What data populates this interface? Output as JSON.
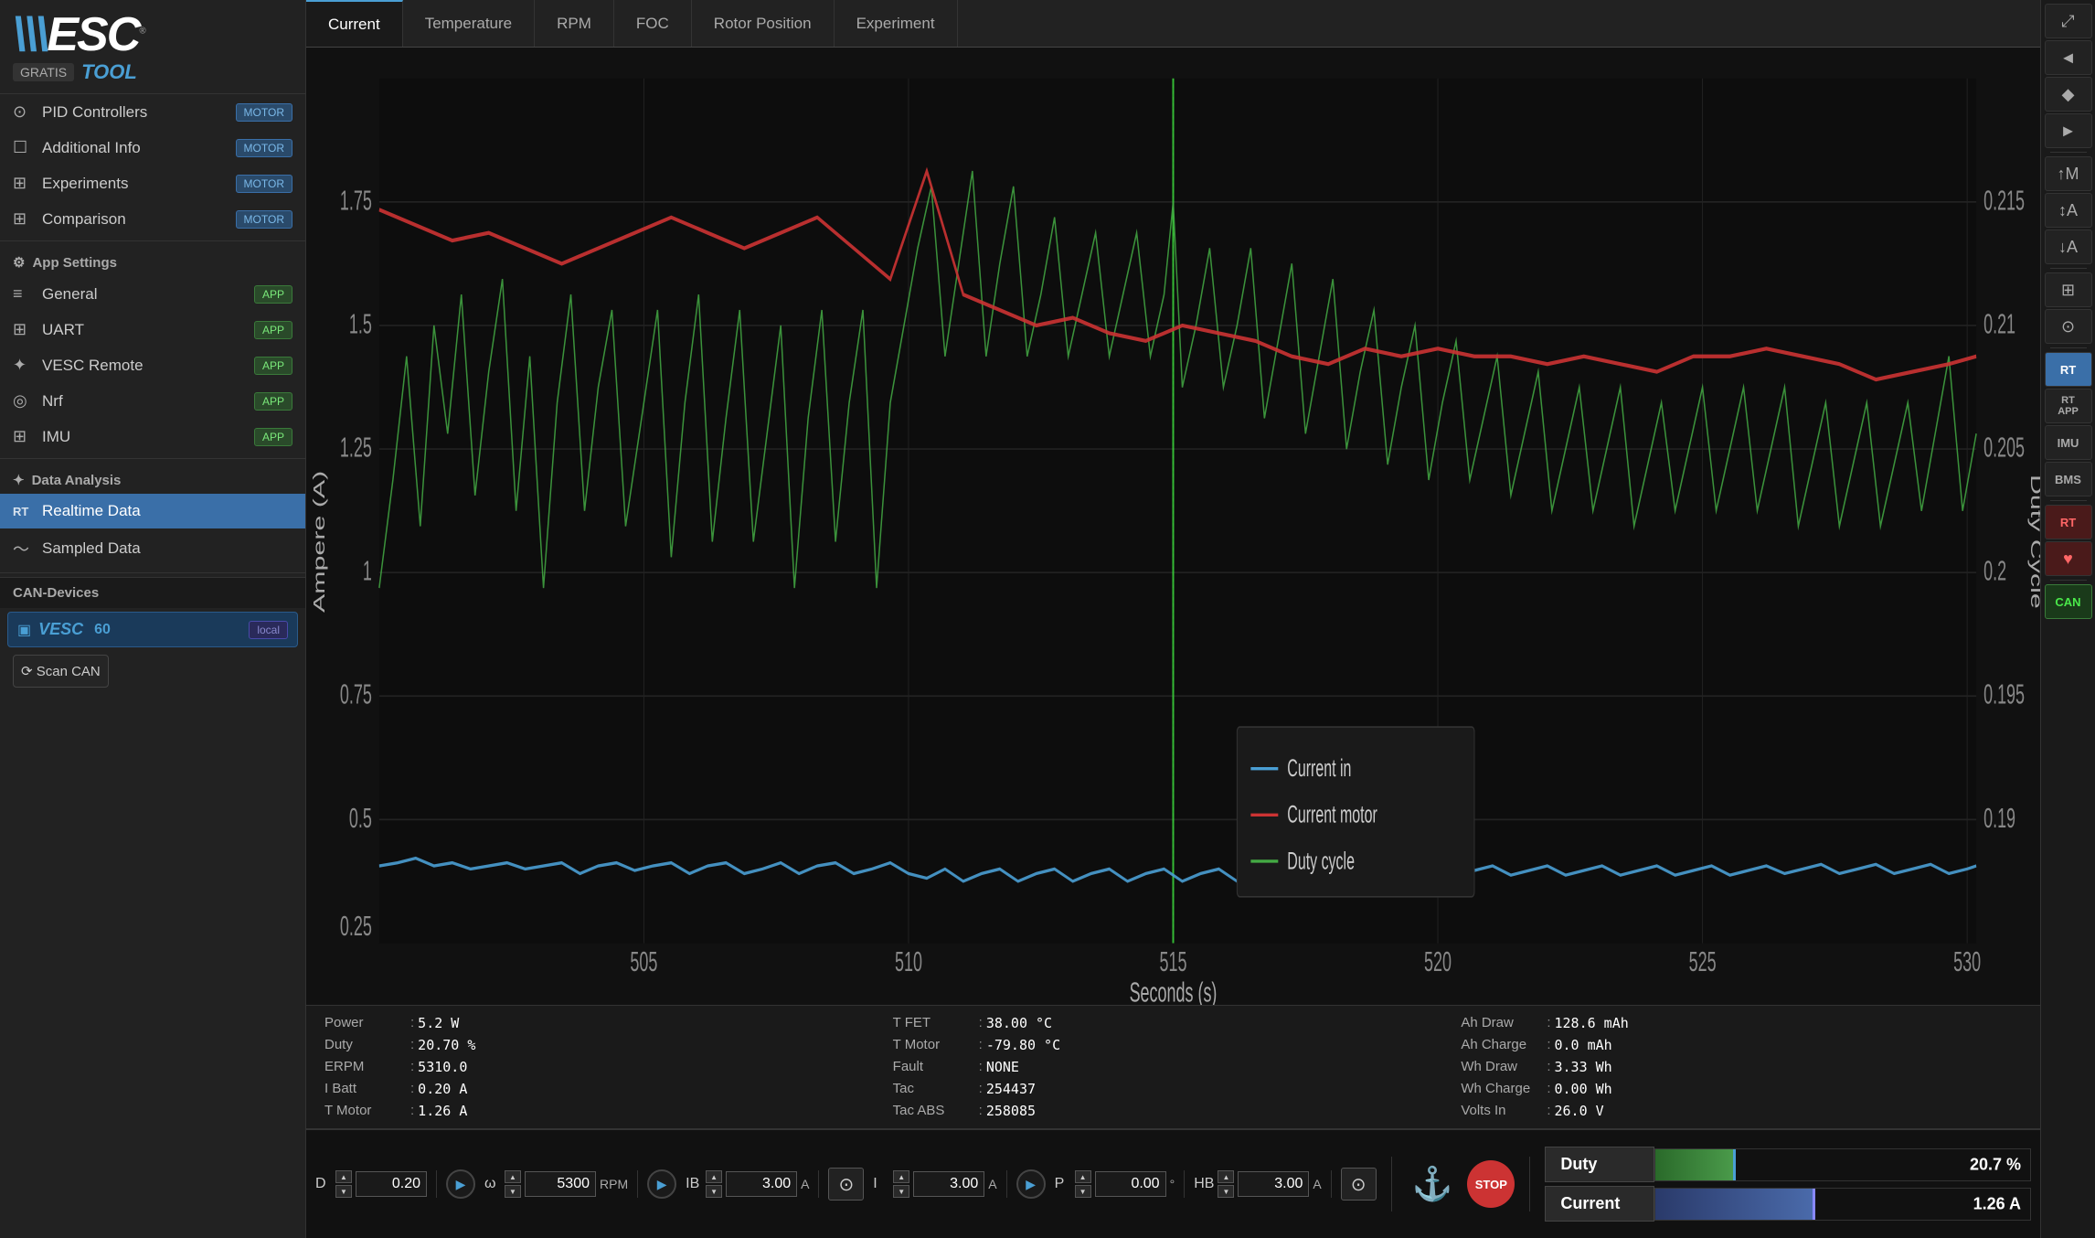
{
  "app": {
    "title": "VESC Tool"
  },
  "logo": {
    "brand": "VESC",
    "gratis": "GRATIS",
    "tool": "TOOL",
    "reg": "®"
  },
  "sidebar": {
    "motor_items": [
      {
        "id": "pid-controllers",
        "label": "PID Controllers",
        "badge": "MOTOR",
        "icon": "⊙"
      },
      {
        "id": "additional-info",
        "label": "Additional Info",
        "badge": "MOTOR",
        "icon": "☐"
      },
      {
        "id": "experiments",
        "label": "Experiments",
        "badge": "MOTOR",
        "icon": "⊞"
      },
      {
        "id": "comparison",
        "label": "Comparison",
        "badge": "MOTOR",
        "icon": "⊞"
      }
    ],
    "app_settings_header": "App Settings",
    "app_items": [
      {
        "id": "general",
        "label": "General",
        "badge": "APP",
        "icon": "≡"
      },
      {
        "id": "uart",
        "label": "UART",
        "badge": "APP",
        "icon": "⊞"
      },
      {
        "id": "vesc-remote",
        "label": "VESC Remote",
        "badge": "APP",
        "icon": "✦"
      },
      {
        "id": "nrf",
        "label": "Nrf",
        "badge": "APP",
        "icon": "((·))"
      },
      {
        "id": "imu",
        "label": "IMU",
        "badge": "APP",
        "icon": "⊞"
      }
    ],
    "data_analysis_header": "Data Analysis",
    "data_items": [
      {
        "id": "realtime-data",
        "label": "Realtime Data",
        "icon": "RT",
        "active": true
      },
      {
        "id": "sampled-data",
        "label": "Sampled Data",
        "icon": "~"
      }
    ],
    "can_devices_header": "CAN-Devices",
    "can_device": {
      "name": "VESC 60",
      "badge": "local",
      "icon": "▣"
    },
    "scan_can_label": "⟳ Scan CAN"
  },
  "tabs": [
    {
      "id": "current",
      "label": "Current",
      "active": true
    },
    {
      "id": "temperature",
      "label": "Temperature"
    },
    {
      "id": "rpm",
      "label": "RPM"
    },
    {
      "id": "foc",
      "label": "FOC"
    },
    {
      "id": "rotor-position",
      "label": "Rotor Position"
    },
    {
      "id": "experiment",
      "label": "Experiment"
    }
  ],
  "chart": {
    "y_axis_left_label": "Ampere (A)",
    "y_axis_right_label": "Duty Cycle",
    "x_axis_label": "Seconds (s)",
    "x_ticks": [
      "505",
      "510",
      "515",
      "520",
      "525",
      "530"
    ],
    "y_left_ticks": [
      "0.25",
      "0.5",
      "0.75",
      "1",
      "1.25",
      "1.5",
      "1.75"
    ],
    "y_right_ticks": [
      "0.19",
      "0.195",
      "0.2",
      "0.205",
      "0.21",
      "0.215"
    ],
    "legend": [
      {
        "id": "current-in",
        "label": "Current in",
        "color": "#4a9fd4"
      },
      {
        "id": "current-motor",
        "label": "Current motor",
        "color": "#cc3333"
      },
      {
        "id": "duty-cycle",
        "label": "Duty cycle",
        "color": "#4a8a4a"
      }
    ]
  },
  "stats": {
    "col1": [
      {
        "key": "Power",
        "sep": ":",
        "val": "5.2 W"
      },
      {
        "key": "Duty",
        "sep": ":",
        "val": "20.70 %"
      },
      {
        "key": "ERPM",
        "sep": ":",
        "val": "5310.0"
      },
      {
        "key": "I Batt",
        "sep": ":",
        "val": "0.20 A"
      },
      {
        "key": "T Motor",
        "sep": ":",
        "val": "1.26 A"
      }
    ],
    "col2": [
      {
        "key": "T FET",
        "sep": ":",
        "val": "38.00 °C"
      },
      {
        "key": "T Motor",
        "sep": ":",
        "val": "-79.80 °C"
      },
      {
        "key": "Fault",
        "sep": ":",
        "val": "NONE"
      },
      {
        "key": "Tac",
        "sep": ":",
        "val": "254437"
      },
      {
        "key": "Tac ABS",
        "sep": ":",
        "val": "258085"
      }
    ],
    "col3": [
      {
        "key": "Ah Draw",
        "sep": ":",
        "val": "128.6 mAh"
      },
      {
        "key": "Ah Charge",
        "sep": ":",
        "val": "0.0 mAh"
      },
      {
        "key": "Wh Draw",
        "sep": ":",
        "val": "3.33 Wh"
      },
      {
        "key": "Wh Charge",
        "sep": ":",
        "val": "0.00 Wh"
      },
      {
        "key": "Volts In",
        "sep": ":",
        "val": "26.0 V"
      }
    ]
  },
  "bottom_controls": {
    "d_label": "D",
    "d_value": "0.20",
    "w_label": "ω",
    "w_value": "5300",
    "w_unit": "RPM",
    "ib_label": "IB",
    "ib_value": "3.00",
    "ib_unit": "A",
    "i_label": "I",
    "i_value": "3.00",
    "i_unit": "A",
    "p_label": "P",
    "p_value": "0.00",
    "p_unit": "°",
    "hb_label": "HB",
    "hb_value": "3.00",
    "hb_unit": "A"
  },
  "duty_panel": {
    "duty_label": "Duty",
    "duty_value": "20.7 %",
    "duty_pct": 20.7,
    "current_label": "Current",
    "current_value": "1.26 A",
    "current_pct": 42
  },
  "right_toolbar": {
    "buttons": [
      {
        "id": "expand",
        "icon": "⤢",
        "active": false
      },
      {
        "id": "left-arrow",
        "icon": "◄",
        "active": false
      },
      {
        "id": "center",
        "icon": "◆",
        "active": false
      },
      {
        "id": "right-arrow",
        "icon": "►",
        "active": false
      },
      {
        "id": "up-arrow",
        "icon": "▲",
        "active": false
      },
      {
        "id": "grid",
        "icon": "⊞",
        "active": false
      },
      {
        "id": "gamepad",
        "icon": "⊙",
        "active": false
      },
      {
        "id": "rt1",
        "icon": "RT",
        "active": true,
        "text": true
      },
      {
        "id": "rt2",
        "icon": "RT APP",
        "active": false,
        "text": true
      },
      {
        "id": "imu",
        "icon": "IMU",
        "active": false,
        "text": true
      },
      {
        "id": "bms",
        "icon": "BMS",
        "active": false,
        "text": true
      },
      {
        "id": "rt3",
        "icon": "RT",
        "active": false,
        "text": true,
        "red": true
      },
      {
        "id": "heart",
        "icon": "♥",
        "active": false,
        "red": true
      },
      {
        "id": "can",
        "icon": "CAN",
        "active": false,
        "text": true,
        "can": true
      }
    ]
  }
}
